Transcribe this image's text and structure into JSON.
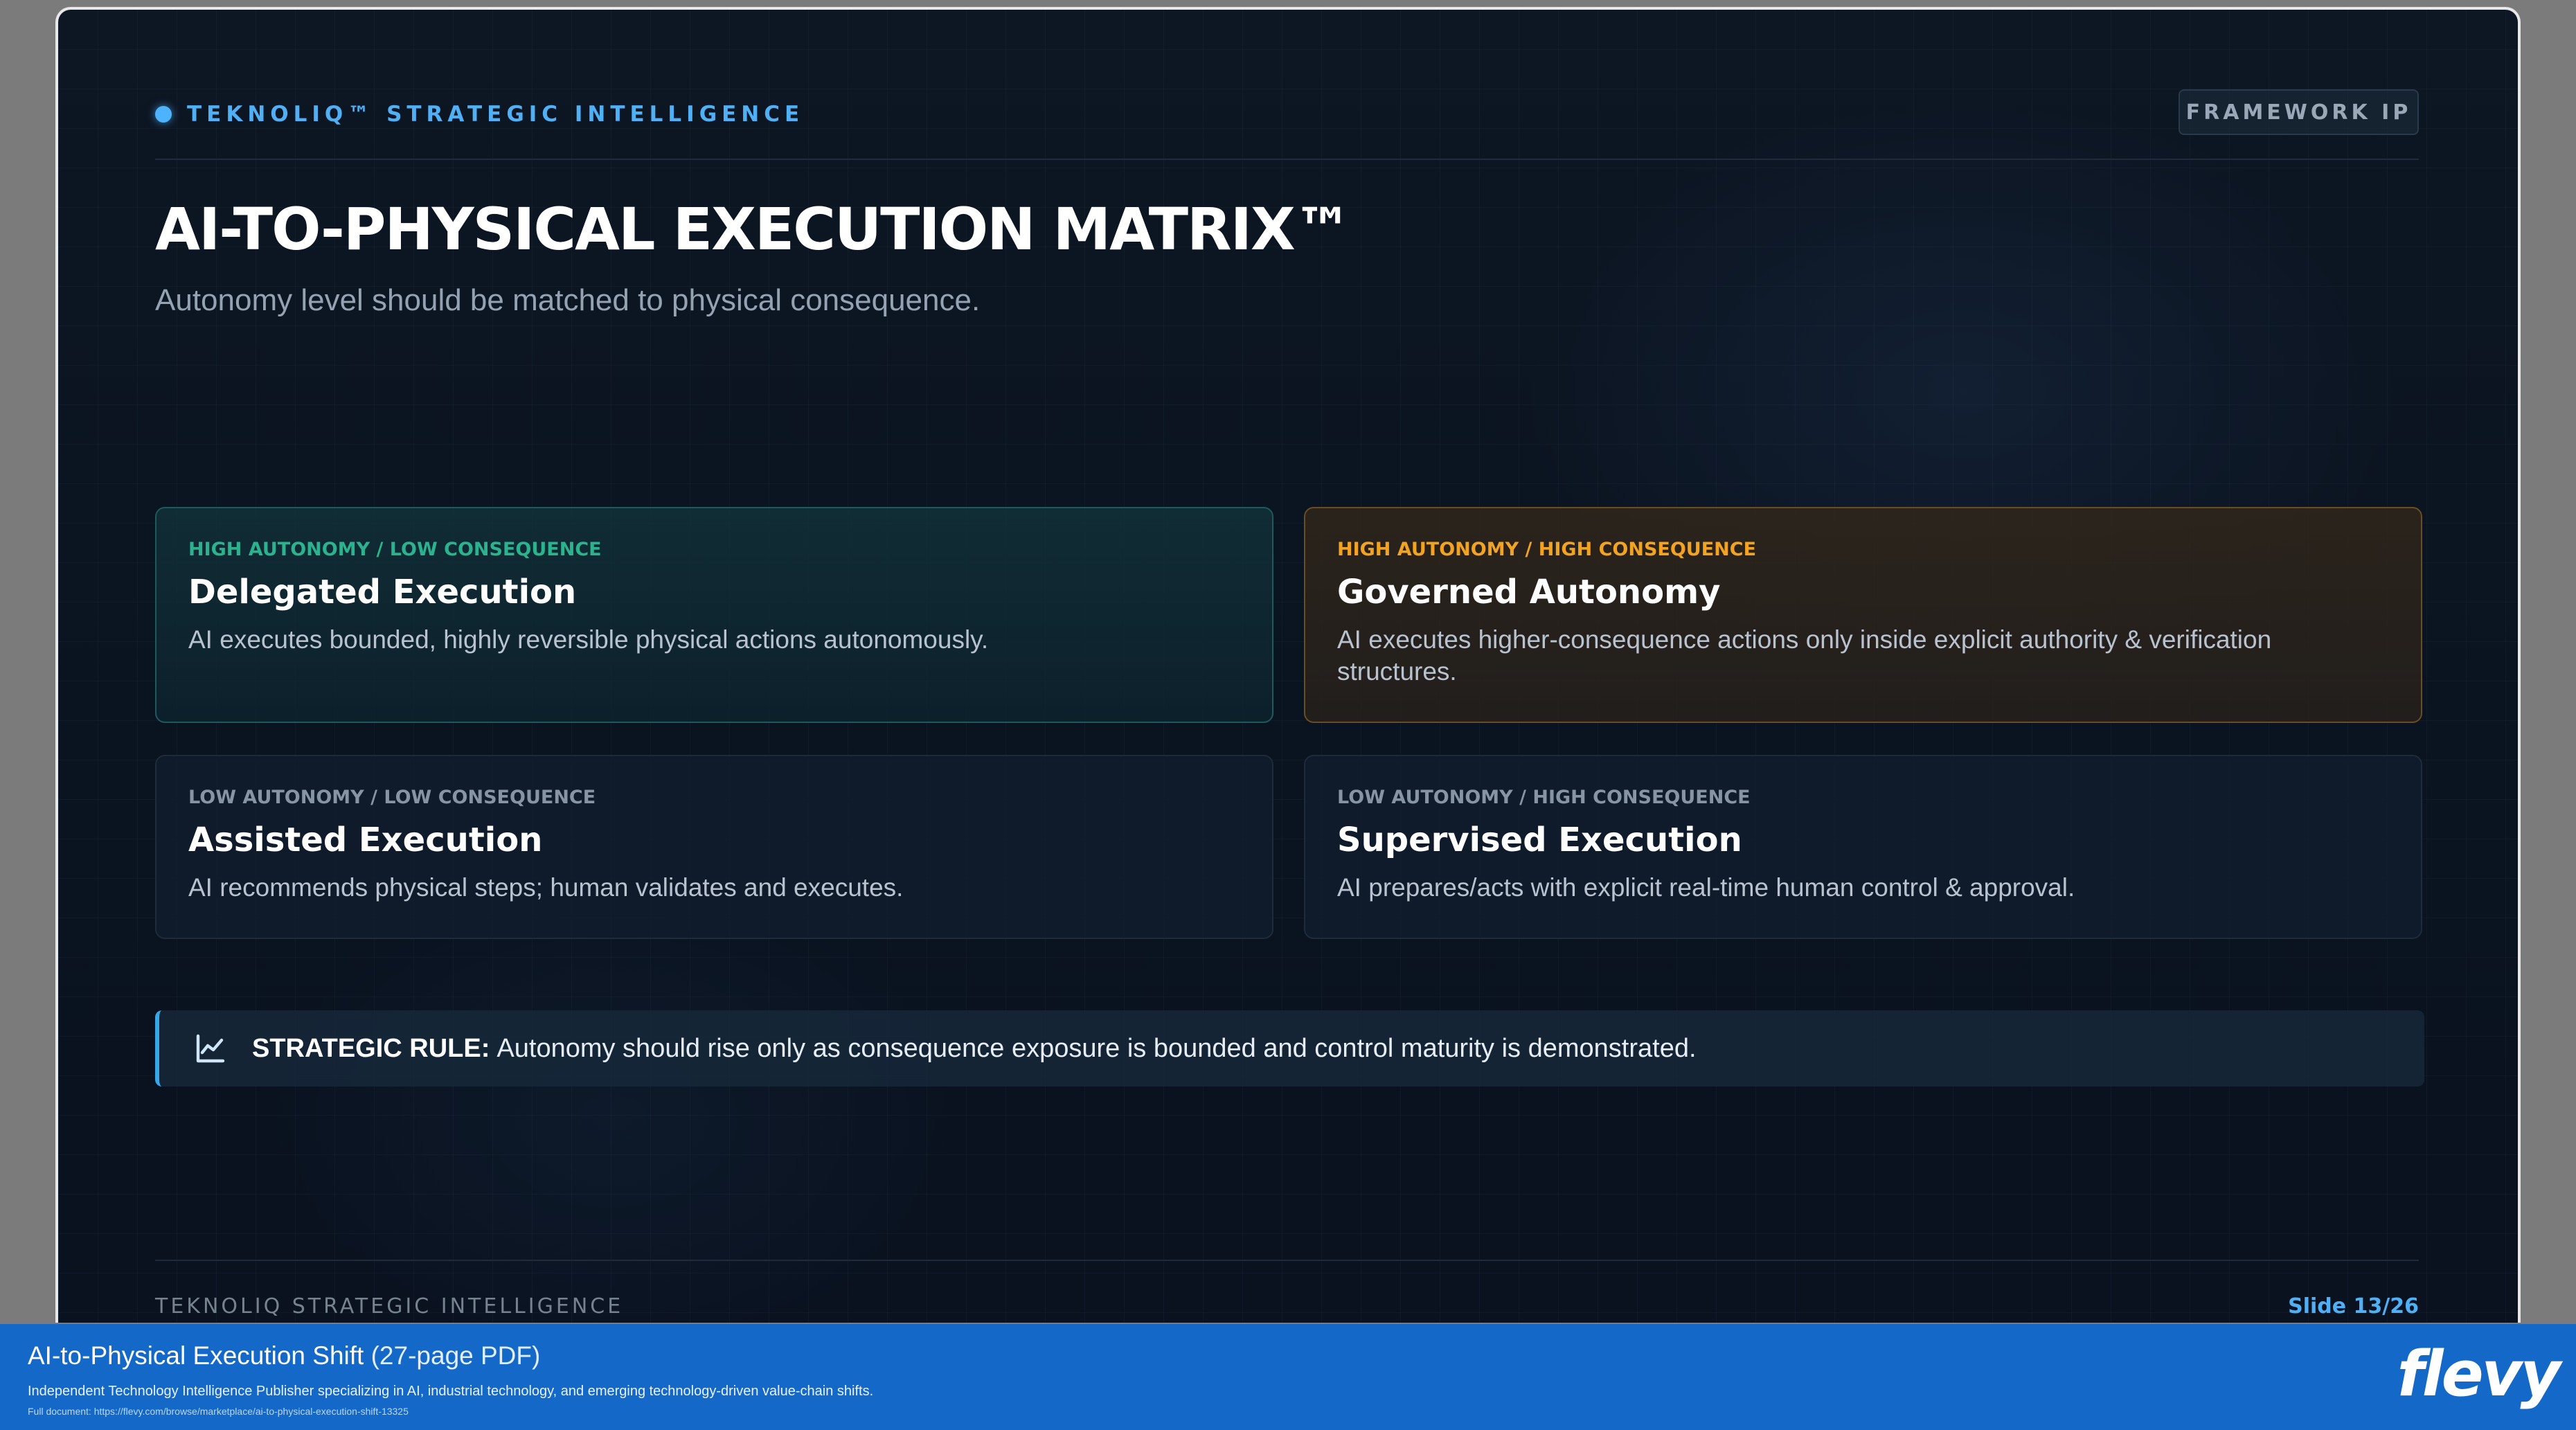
{
  "header": {
    "brand": "TEKNOLIQ™ STRATEGIC INTELLIGENCE",
    "badge": "FRAMEWORK IP"
  },
  "slide": {
    "title": "AI-TO-PHYSICAL EXECUTION MATRIX™",
    "subtitle": "Autonomy level should be matched to physical consequence."
  },
  "quadrants": [
    {
      "tag": "HIGH AUTONOMY / LOW CONSEQUENCE",
      "title": "Delegated Execution",
      "description": "AI executes bounded, highly reversible physical actions autonomously."
    },
    {
      "tag": "HIGH AUTONOMY / HIGH CONSEQUENCE",
      "title": "Governed Autonomy",
      "description": "AI executes higher-consequence actions only inside explicit authority & verification structures."
    },
    {
      "tag": "LOW AUTONOMY / LOW CONSEQUENCE",
      "title": "Assisted Execution",
      "description": "AI recommends physical steps; human validates and executes."
    },
    {
      "tag": "LOW AUTONOMY / HIGH CONSEQUENCE",
      "title": "Supervised Execution",
      "description": "AI prepares/acts with explicit real-time human control & approval."
    }
  ],
  "rule": {
    "icon": "trend-chart-icon",
    "label": "STRATEGIC RULE:",
    "text": "Autonomy should rise only as consequence exposure is bounded and control maturity is demonstrated."
  },
  "footer": {
    "brand": "TEKNOLIQ STRATEGIC INTELLIGENCE",
    "slide_number": "Slide 13/26"
  },
  "banner": {
    "title": "AI-to-Physical Execution Shift",
    "pages": "(27-page PDF)",
    "description": "Independent Technology Intelligence Publisher specializing in AI, industrial technology, and emerging technology-driven value-chain shifts.",
    "link": "Full document: https://flevy.com/browse/marketplace/ai-to-physical-execution-shift-13325",
    "logo": "flevy"
  },
  "colors": {
    "accent_blue": "#4fb0f5",
    "low_consequence_green": "#2bb38f",
    "high_consequence_amber": "#f2a322",
    "banner_blue": "#1469c8"
  }
}
